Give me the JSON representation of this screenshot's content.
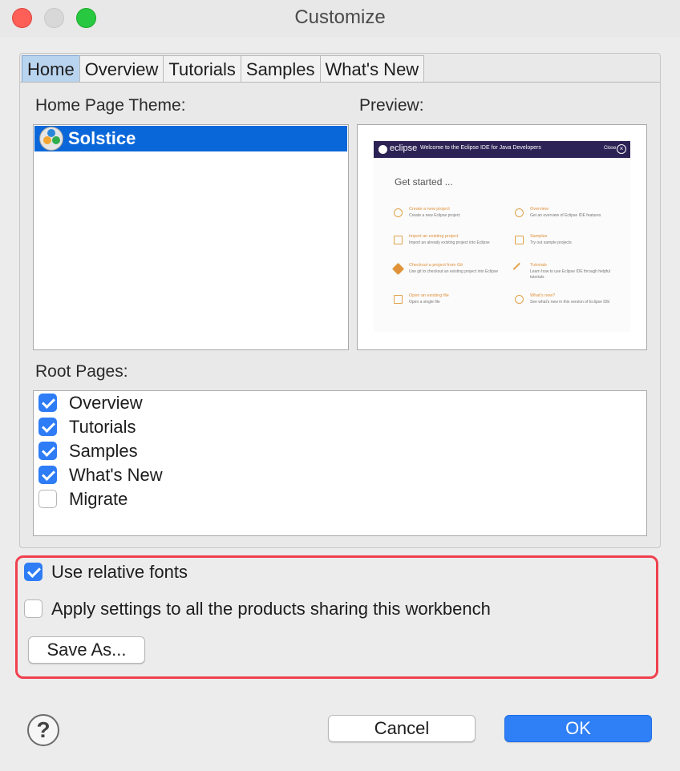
{
  "window": {
    "title": "Customize"
  },
  "tabs": [
    {
      "label": "Home"
    },
    {
      "label": "Overview"
    },
    {
      "label": "Tutorials"
    },
    {
      "label": "Samples"
    },
    {
      "label": "What's New"
    }
  ],
  "home": {
    "theme_label": "Home Page Theme:",
    "selected_theme": "Solstice",
    "preview_label": "Preview:",
    "root_pages_label": "Root Pages:",
    "root_pages": [
      {
        "label": "Overview",
        "checked": true
      },
      {
        "label": "Tutorials",
        "checked": true
      },
      {
        "label": "Samples",
        "checked": true
      },
      {
        "label": "What's New",
        "checked": true
      },
      {
        "label": "Migrate",
        "checked": false
      }
    ]
  },
  "preview": {
    "logo": "eclipse",
    "welcome": "Welcome to the Eclipse IDE for Java Developers",
    "close": "Close",
    "heading": "Get started ...",
    "items": [
      {
        "title": "Create a new project",
        "desc": "Create a new Eclipse project"
      },
      {
        "title": "Overview",
        "desc": "Get an overview of Eclipse IDE features"
      },
      {
        "title": "Import an existing project",
        "desc": "Import an already existing project into Eclipse"
      },
      {
        "title": "Samples",
        "desc": "Try out sample projects"
      },
      {
        "title": "Checkout a project from Git",
        "desc": "Use git to checkout an existing project into Eclipse"
      },
      {
        "title": "Tutorials",
        "desc": "Learn how to use Eclipse IDE through helpful tutorials"
      },
      {
        "title": "Open an existing file",
        "desc": "Open a single file"
      },
      {
        "title": "What's new?",
        "desc": "See what's new in this version of Eclipse IDE"
      }
    ]
  },
  "options": {
    "relative_fonts": {
      "label": "Use relative fonts",
      "checked": true
    },
    "apply_all": {
      "label": "Apply settings to all the products sharing this workbench",
      "checked": false
    },
    "save_as": "Save As..."
  },
  "footer": {
    "help": "?",
    "cancel": "Cancel",
    "ok": "OK"
  },
  "colors": {
    "accent": "#2f7ff6",
    "selection": "#0a67d9",
    "highlight_border": "#f0414f"
  }
}
